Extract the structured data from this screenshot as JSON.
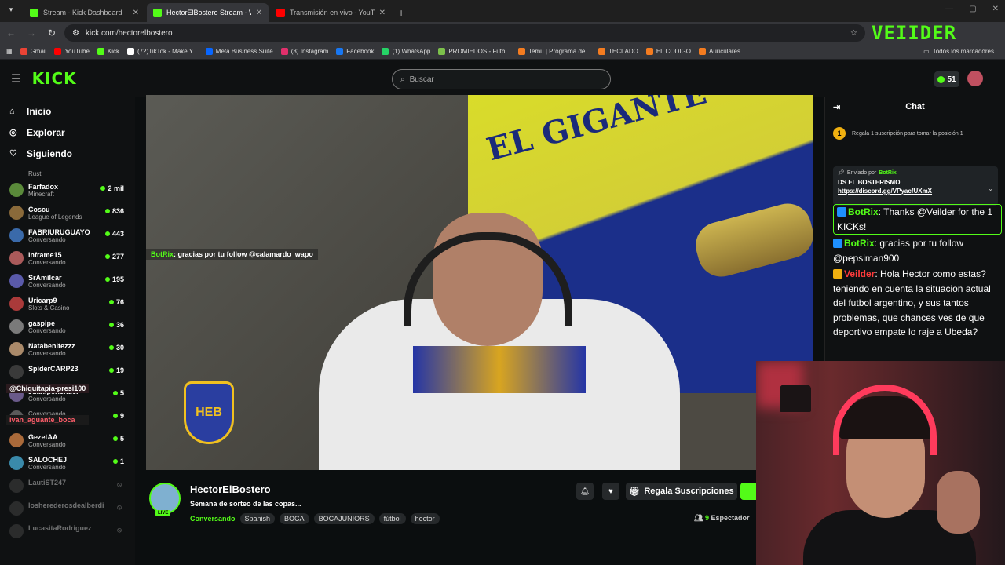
{
  "browser": {
    "tabs": [
      {
        "label": "Stream - Kick Dashboard",
        "color": "#53fc18",
        "active": false
      },
      {
        "label": "HectorElBostero Stream - W",
        "color": "#53fc18",
        "active": true
      },
      {
        "label": "Transmisión en vivo - YouTube",
        "color": "#ff0000",
        "active": false
      }
    ],
    "new_tab": "+",
    "url": "kick.com/hectorelbostero",
    "bookmarks": [
      {
        "label": "Gmail",
        "color": "#ea4335"
      },
      {
        "label": "YouTube",
        "color": "#ff0000"
      },
      {
        "label": "Kick",
        "color": "#53fc18"
      },
      {
        "label": "(72)TikTok - Make Y...",
        "color": "#ffffff"
      },
      {
        "label": "Meta Business Suite",
        "color": "#0866ff"
      },
      {
        "label": "(3) Instagram",
        "color": "#e1306c"
      },
      {
        "label": "Facebook",
        "color": "#1877f2"
      },
      {
        "label": "(1) WhatsApp",
        "color": "#25d366"
      },
      {
        "label": "PROMIEDOS - Futb...",
        "color": "#7cc04b"
      },
      {
        "label": "Temu | Programa de...",
        "color": "#f47c20"
      },
      {
        "label": "TECLADO",
        "color": "#f47c20"
      },
      {
        "label": "EL CODIGO",
        "color": "#f47c20"
      },
      {
        "label": "Auriculares",
        "color": "#f47c20"
      }
    ],
    "all_bookmarks": "Todos los marcadores"
  },
  "kick": {
    "logo": "KICK",
    "search_placeholder": "Buscar",
    "kicks_count": "51",
    "nav": [
      {
        "label": "Inicio",
        "icon": "home-icon"
      },
      {
        "label": "Explorar",
        "icon": "compass-icon"
      },
      {
        "label": "Siguiendo",
        "icon": "heart-icon"
      }
    ],
    "rust_label": "Rust",
    "channels": [
      {
        "name": "Farfadox",
        "game": "Minecraft",
        "viewers": "2 mil",
        "color": "#5a8a3a",
        "live": true
      },
      {
        "name": "Coscu",
        "game": "League of Legends",
        "viewers": "836",
        "color": "#8a6a3a",
        "live": true
      },
      {
        "name": "FABRIURUGUAYO",
        "game": "Conversando",
        "viewers": "443",
        "color": "#3a6aaa",
        "live": true
      },
      {
        "name": "inframe15",
        "game": "Conversando",
        "viewers": "277",
        "color": "#aa5a5a",
        "live": true
      },
      {
        "name": "SrAmilcar",
        "game": "Conversando",
        "viewers": "195",
        "color": "#5a5aaa",
        "live": true
      },
      {
        "name": "Uricarp9",
        "game": "Slots & Casino",
        "viewers": "76",
        "color": "#aa3a3a",
        "live": true
      },
      {
        "name": "gaspipe",
        "game": "Conversando",
        "viewers": "36",
        "color": "#7a7a7a",
        "live": true
      },
      {
        "name": "Natabenitezzz",
        "game": "Conversando",
        "viewers": "30",
        "color": "#aa8a6a",
        "live": true
      },
      {
        "name": "SpiderCARP23",
        "game": "",
        "viewers": "19",
        "color": "#3a3a3a",
        "live": true
      },
      {
        "name": "Juaniperlender",
        "game": "Conversando",
        "viewers": "5",
        "color": "#6a5a8a",
        "live": true
      },
      {
        "name": "",
        "game": "Conversando",
        "viewers": "9",
        "color": "#5a5a5a",
        "live": true
      },
      {
        "name": "GezetAA",
        "game": "Conversando",
        "viewers": "5",
        "color": "#aa6a3a",
        "live": true
      },
      {
        "name": "SALOCHEJ",
        "game": "Conversando",
        "viewers": "1",
        "color": "#3a8aaa",
        "live": true
      },
      {
        "name": "LautiST247",
        "game": "",
        "viewers": "",
        "color": "#555555",
        "live": false
      },
      {
        "name": "losherederosdealberdi",
        "game": "",
        "viewers": "",
        "color": "#555555",
        "live": false
      },
      {
        "name": "LucasitaRodriguez",
        "game": "",
        "viewers": "",
        "color": "#555555",
        "live": false
      }
    ],
    "overlay_names": [
      "@Chiquitapia-presi100",
      "ivan_aguante_boca"
    ]
  },
  "video": {
    "chat_user": "BotRix",
    "chat_text": ": gracias por tu follow @calamardo_wapo",
    "poster_text": "EL GIGANTE",
    "logo_text": "HEB"
  },
  "stream": {
    "name": "HectorElBostero",
    "title": "Semana de sorteo de las copas...",
    "category": "Conversando",
    "tags": [
      "Spanish",
      "BOCA",
      "BOCAJUNIORS",
      "fútbol",
      "hector"
    ],
    "gift_label": "Regala Suscripciones",
    "viewers_count": "9",
    "viewers_label": "Espectador",
    "live_label": "LIVE"
  },
  "chat": {
    "title": "Chat",
    "goal_rank": "1",
    "goal_text": "Regala 1 suscripción para tomar la posición 1",
    "pinned_by_label": "Enviado por",
    "pinned_by_user": "BotRix",
    "pinned_msg": "DS EL BOSTERISMO",
    "pinned_link": "https://discord.gg/VPyacfUXmX",
    "messages": [
      {
        "user": "BotRix",
        "text": ": Thanks @Veilder for the 1 KICKs!",
        "color": "#53fc18",
        "badge": "#1e90ff"
      },
      {
        "user": "BotRix",
        "text": ": gracias por tu follow @pepsiman900",
        "color": "#53fc18",
        "badge": "#1e90ff"
      },
      {
        "user": "Veilder",
        "text": ": Hola Hector como estas? teniendo en cuenta la situacion actual del futbol argentino, y sus tantos problemas, que chances ves de que deportivo empate lo raje a Ubeda?",
        "color": "#ff3b3b",
        "badge": "#f0b010"
      }
    ]
  },
  "overlay": {
    "brand": "VEIIDER"
  }
}
